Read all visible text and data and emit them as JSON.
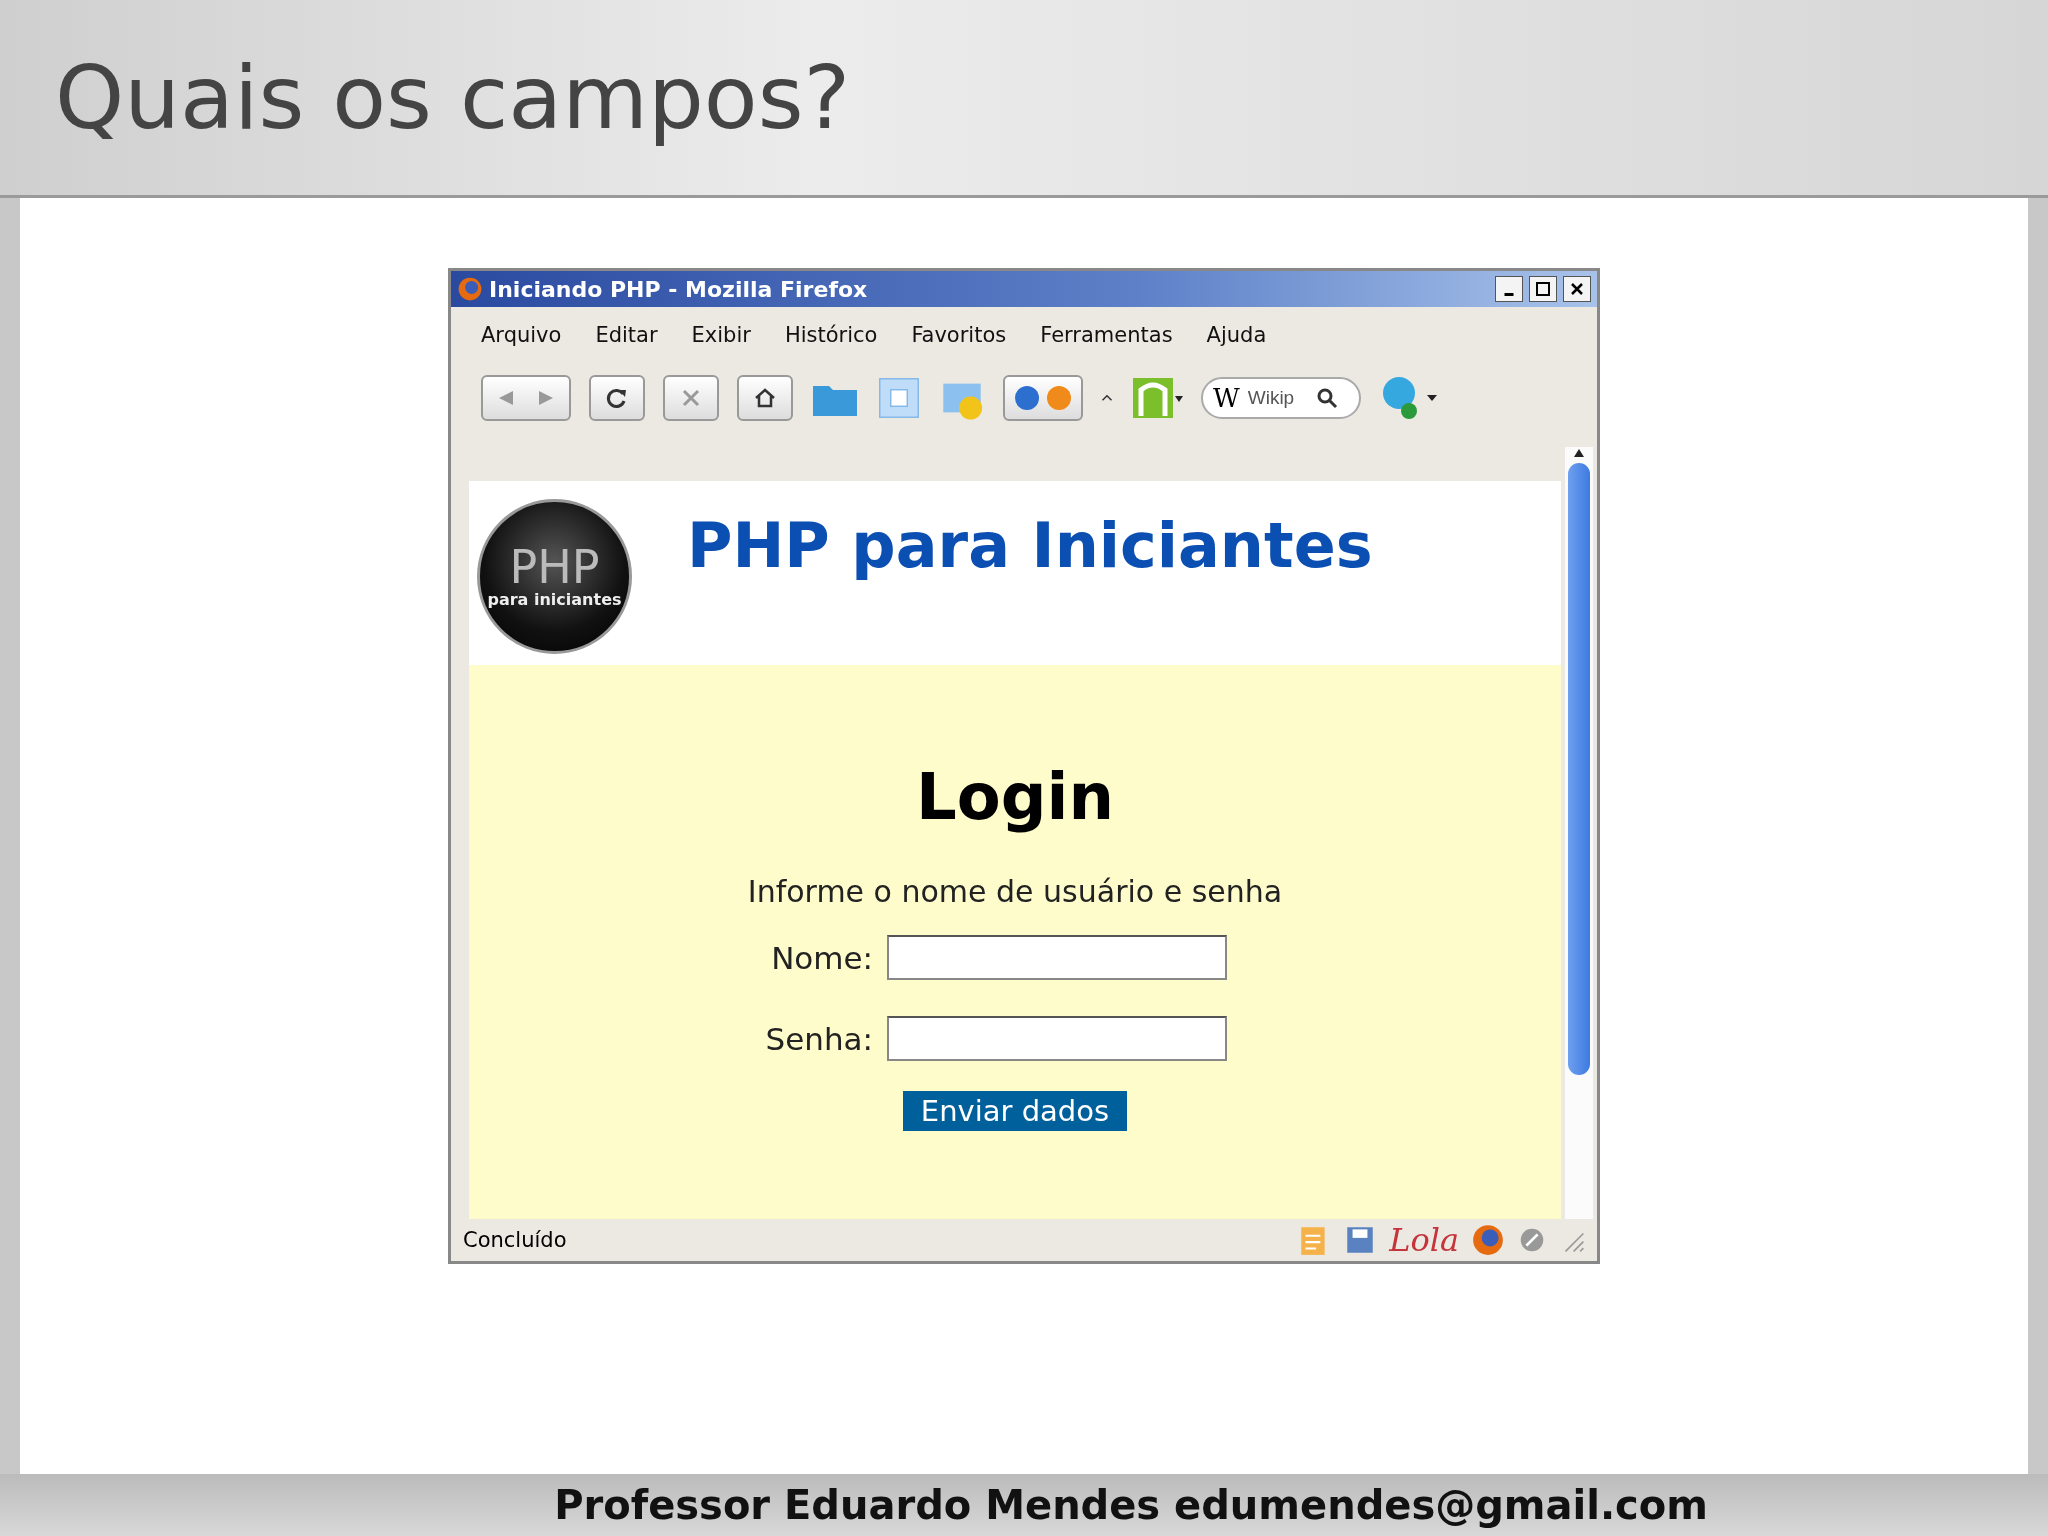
{
  "slide": {
    "title": "Quais os campos?",
    "footer": "Professor Eduardo Mendes edumendes@gmail.com"
  },
  "browser": {
    "title": "Iniciando PHP - Mozilla Firefox",
    "menu": [
      "Arquivo",
      "Editar",
      "Exibir",
      "Histórico",
      "Favoritos",
      "Ferramentas",
      "Ajuda"
    ],
    "search": {
      "engine": "W",
      "placeholder": "Wikip"
    },
    "page": {
      "logo": {
        "big": "PHP",
        "small": "para iniciantes"
      },
      "heading": "PHP para Iniciantes",
      "login_title": "Login",
      "instruction": "Informe o nome de usuário e senha",
      "fields": [
        {
          "label": "Nome:"
        },
        {
          "label": "Senha:"
        }
      ],
      "submit": "Enviar dados"
    },
    "status": {
      "text": "Concluído",
      "addon": "Lola"
    }
  }
}
